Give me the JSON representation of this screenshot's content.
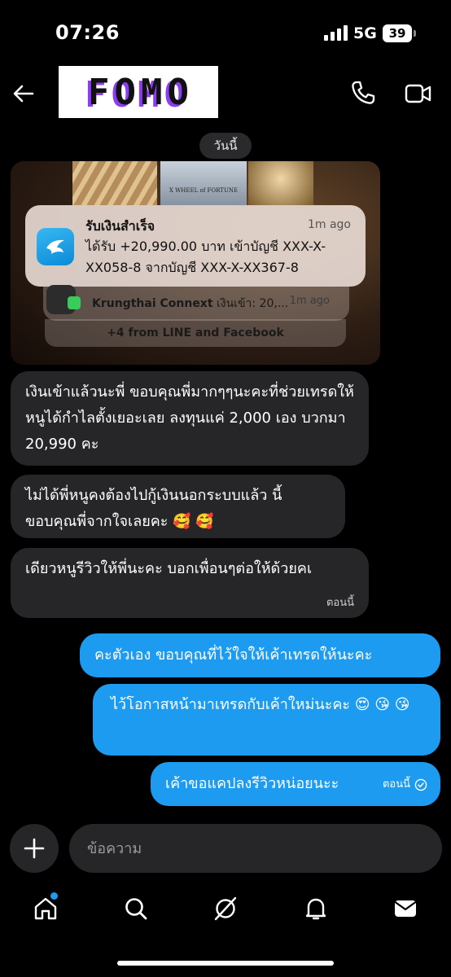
{
  "status_bar": {
    "time": "07:26",
    "network": "5G",
    "battery": "39"
  },
  "header": {
    "logo_letters": [
      "F",
      "O",
      "M",
      "O"
    ],
    "logo_accent_color": "#8b3df0"
  },
  "date_pill": "วันนี้",
  "image_message": {
    "tile_caption": "X  WHEEL of FORTUNE",
    "notification": {
      "title": "รับเงินสำเร็จ",
      "time": "1m ago",
      "body": "ได้รับ +20,990.00 บาท เข้าบัญชี XXX-X-XX058-8 จากบัญชี XXX-X-XX367-8"
    },
    "stacked_notification": {
      "app": "Krungthai Connext",
      "text": "เงินเข้า: 20,...",
      "time": "1m ago",
      "icon_label": "Connext"
    },
    "more_notifications": "+4 from LINE and Facebook"
  },
  "messages": [
    {
      "direction": "in",
      "text": "เงินเข้าแล้วนะพี่ ขอบคุณพี่มากๆๆนะคะที่ช่วยเทรดให้หนูได้กำไลตั้งเยอะเลย ลงทุนแค่ 2,000 เอง บวกมา 20,990 คะ"
    },
    {
      "direction": "in",
      "text": "ไม่ได้พี่หนูคงต้องไปกู้เงินนอกระบบแล้ว นี้ขอบคุณพี่จากใจเลยคะ 🥰 🥰"
    },
    {
      "direction": "in",
      "text": "เดียวหนูรีวิวให้พี่นะคะ บอกเพื่อนๆต่อให้ด้วยคเ",
      "stamp": "ตอนนี้"
    },
    {
      "direction": "out",
      "text": "คะตัวเอง ขอบคุณที่ไว้ใจให้เค้าเทรดให้นะคะ"
    },
    {
      "direction": "out",
      "text": "ไว้โอกาสหน้ามาเทรดกับเค้าใหม่นะคะ 😍 😘 😘"
    },
    {
      "direction": "out",
      "text": "เค้าขอแคปลงรีวิวหน่อยนะะ",
      "stamp": "ตอนนี้"
    }
  ],
  "composer": {
    "placeholder": "ข้อความ"
  },
  "nav": {
    "items": [
      "home-icon",
      "search-icon",
      "explore-icon",
      "notifications-icon",
      "messages-icon"
    ],
    "badge_color": "#1d9bf0"
  },
  "colors": {
    "incoming_bubble": "#262628",
    "outgoing_bubble": "#1d9bf0",
    "background": "#000000"
  }
}
